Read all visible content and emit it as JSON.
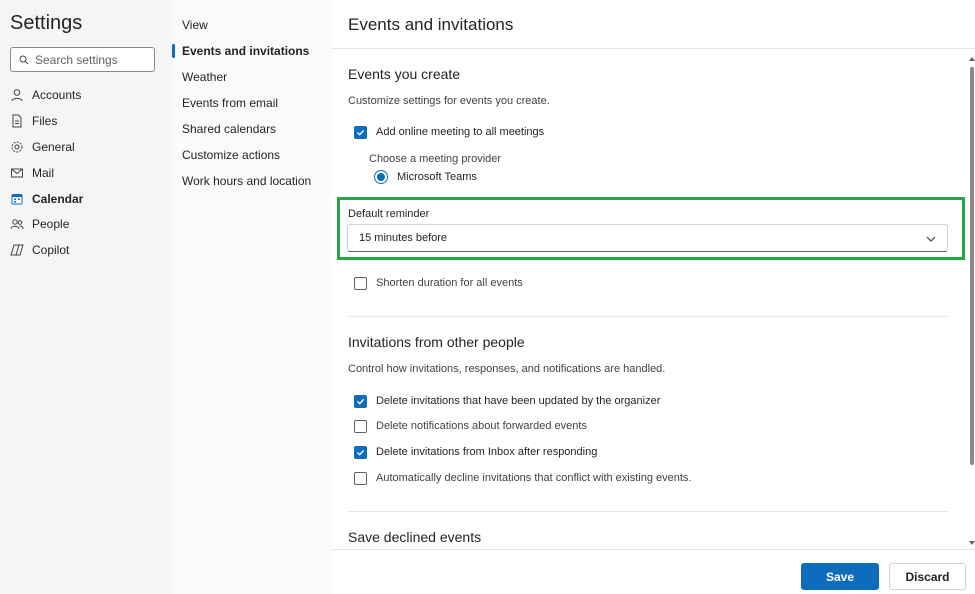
{
  "left_nav": {
    "title": "Settings",
    "search_placeholder": "Search settings",
    "items": [
      {
        "label": "Accounts",
        "icon": "person-icon"
      },
      {
        "label": "Files",
        "icon": "file-icon"
      },
      {
        "label": "General",
        "icon": "gear-icon"
      },
      {
        "label": "Mail",
        "icon": "mail-icon"
      },
      {
        "label": "Calendar",
        "icon": "calendar-icon",
        "active": true
      },
      {
        "label": "People",
        "icon": "people-icon"
      },
      {
        "label": "Copilot",
        "icon": "copilot-icon"
      }
    ]
  },
  "sub_nav": {
    "items": [
      {
        "label": "View"
      },
      {
        "label": "Events and invitations",
        "active": true
      },
      {
        "label": "Weather"
      },
      {
        "label": "Events from email"
      },
      {
        "label": "Shared calendars"
      },
      {
        "label": "Customize actions"
      },
      {
        "label": "Work hours and location"
      }
    ]
  },
  "main": {
    "title": "Events and invitations",
    "events_you_create": {
      "title": "Events you create",
      "description": "Customize settings for events you create.",
      "add_online_meeting": {
        "label": "Add online meeting to all meetings",
        "checked": true
      },
      "provider_label": "Choose a meeting provider",
      "provider_option": "Microsoft Teams",
      "reminder_label": "Default reminder",
      "reminder_value": "15 minutes before",
      "shorten_duration": {
        "label": "Shorten duration for all events",
        "checked": false
      }
    },
    "invitations": {
      "title": "Invitations from other people",
      "description": "Control how invitations, responses, and notifications are handled.",
      "options": [
        {
          "label": "Delete invitations that have been updated by the organizer",
          "checked": true
        },
        {
          "label": "Delete notifications about forwarded events",
          "checked": false
        },
        {
          "label": "Delete invitations from Inbox after responding",
          "checked": true
        },
        {
          "label": "Automatically decline invitations that conflict with existing events.",
          "checked": false
        }
      ]
    },
    "save_declined": {
      "title": "Save declined events"
    }
  },
  "footer": {
    "save_label": "Save",
    "discard_label": "Discard"
  },
  "colors": {
    "accent": "#0f6cbd",
    "highlight_border": "#22aa44",
    "nav_bg": "#f5f5f5"
  }
}
